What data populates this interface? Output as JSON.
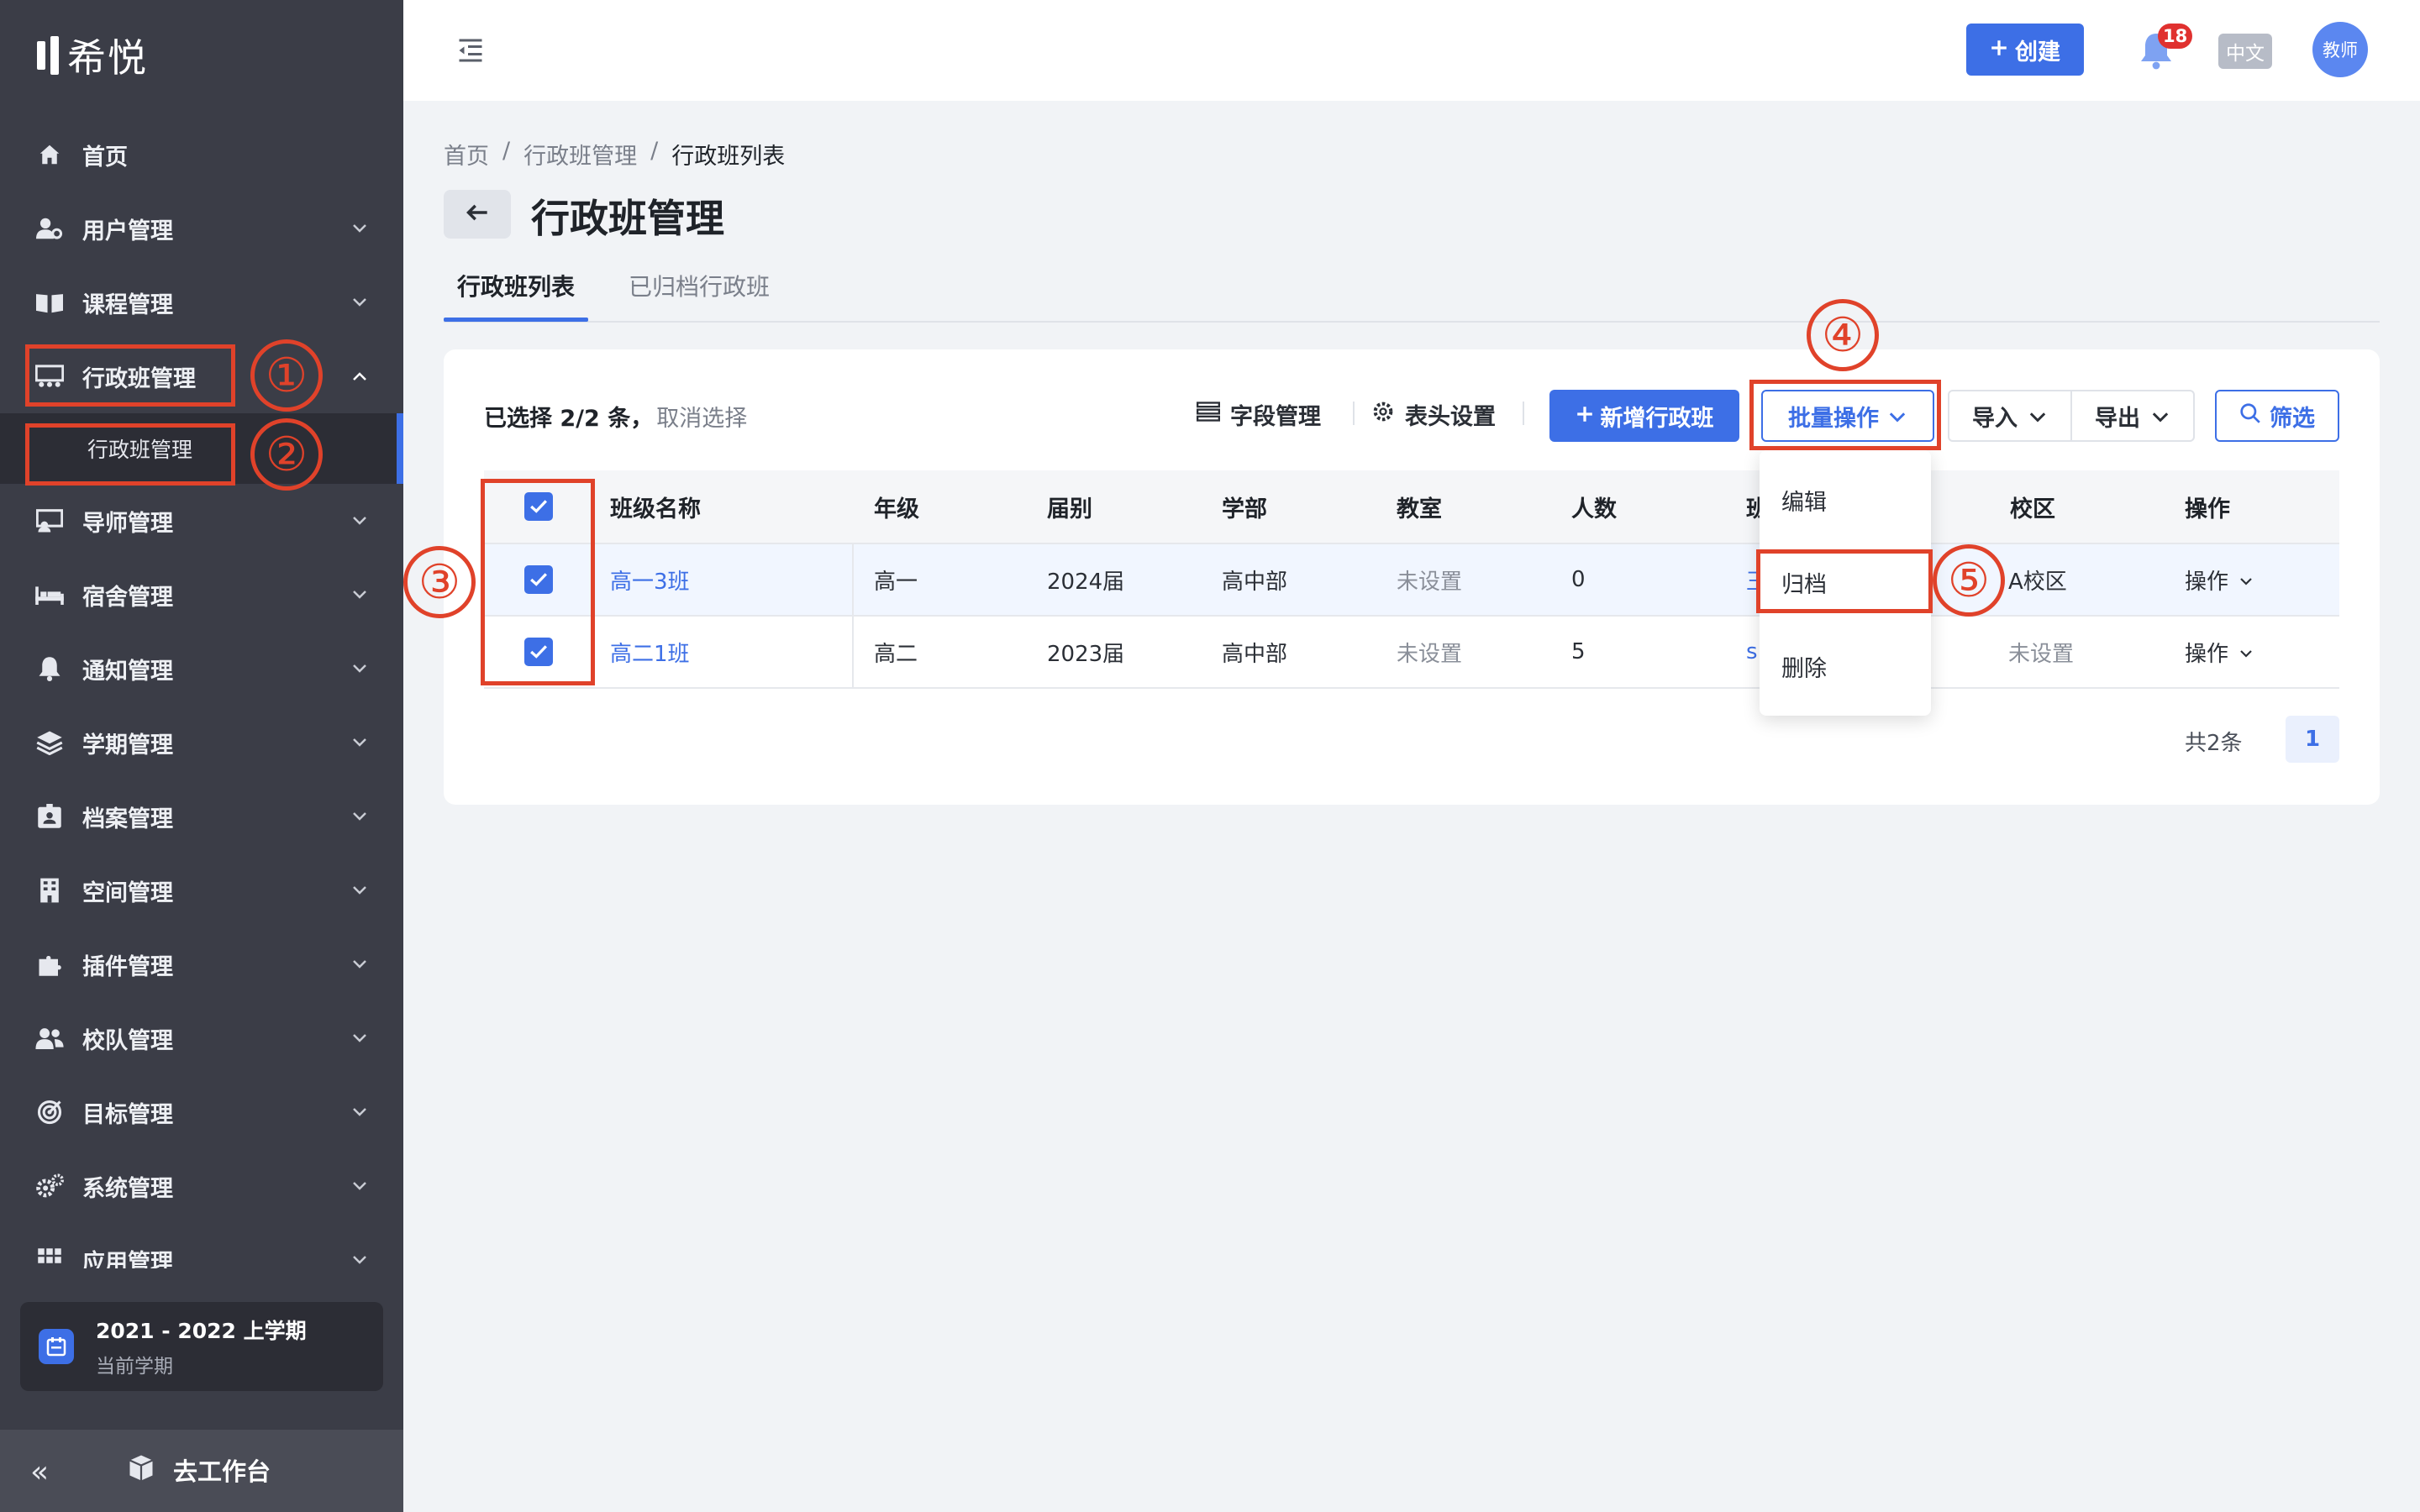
{
  "sidebar": {
    "logo_text": "希悦",
    "items": [
      {
        "label": "首页",
        "icon": "home-icon"
      },
      {
        "label": "用户管理",
        "icon": "user-gear-icon"
      },
      {
        "label": "课程管理",
        "icon": "book-icon"
      },
      {
        "label": "行政班管理",
        "icon": "classroom-icon"
      },
      {
        "label": "导师管理",
        "icon": "mentor-icon"
      },
      {
        "label": "宿舍管理",
        "icon": "bed-icon"
      },
      {
        "label": "通知管理",
        "icon": "bell-icon"
      },
      {
        "label": "学期管理",
        "icon": "layers-icon"
      },
      {
        "label": "档案管理",
        "icon": "id-card-icon"
      },
      {
        "label": "空间管理",
        "icon": "building-icon"
      },
      {
        "label": "插件管理",
        "icon": "puzzle-icon"
      },
      {
        "label": "校队管理",
        "icon": "team-icon"
      },
      {
        "label": "目标管理",
        "icon": "target-icon"
      },
      {
        "label": "系统管理",
        "icon": "gears-icon"
      },
      {
        "label": "应用管理",
        "icon": "apps-icon"
      }
    ],
    "sub_item": "行政班管理",
    "term": {
      "title": "2021 - 2022 上学期",
      "subtitle": "当前学期"
    },
    "collapse": "«",
    "workbench": "去工作台"
  },
  "topbar": {
    "create_label": "创建",
    "notification_count": "18",
    "lang": "中文",
    "avatar": "教师"
  },
  "breadcrumb": [
    "首页",
    "行政班管理",
    "行政班列表"
  ],
  "breadcrumb_sep": "/",
  "page_title": "行政班管理",
  "tabs": [
    "行政班列表",
    "已归档行政班"
  ],
  "toolbar": {
    "selected_text": "已选择 2/2 条，",
    "cancel_select": "取消选择",
    "field_manage": "字段管理",
    "header_settings": "表头设置",
    "add_class": "新增行政班",
    "batch": "批量操作",
    "import": "导入",
    "export": "导出",
    "filter": "筛选"
  },
  "table": {
    "headers": [
      "班级名称",
      "年级",
      "届别",
      "学部",
      "教室",
      "人数",
      "班",
      "校区",
      "操作"
    ],
    "rows": [
      {
        "name": "高一3班",
        "grade": "高一",
        "cohort": "2024届",
        "division": "高中部",
        "room": "未设置",
        "count": "0",
        "teacher": "王",
        "campus": "A校区",
        "op": "操作"
      },
      {
        "name": "高二1班",
        "grade": "高二",
        "cohort": "2023届",
        "division": "高中部",
        "room": "未设置",
        "count": "5",
        "teacher": "s",
        "campus": "未设置",
        "op": "操作"
      }
    ]
  },
  "pager": {
    "total": "共2条",
    "page": "1"
  },
  "dropdown": [
    "编辑",
    "归档",
    "删除"
  ],
  "annotations": [
    "①",
    "②",
    "③",
    "④",
    "⑤"
  ],
  "colors": {
    "accent": "#3d6fe6",
    "sidebar_bg": "#3b3d47",
    "annotation": "#e0422a"
  }
}
